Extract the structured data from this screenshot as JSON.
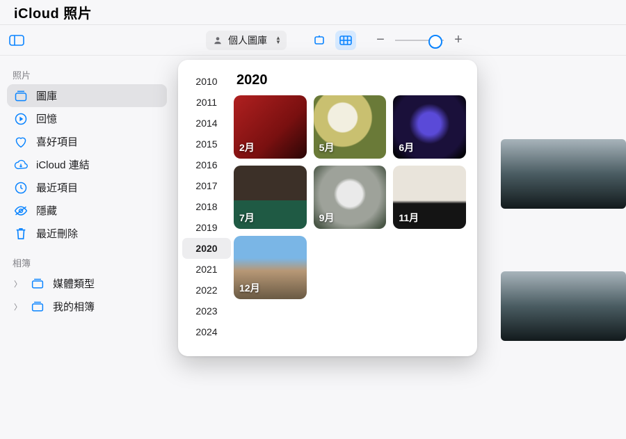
{
  "header": {
    "app_name": "iCloud",
    "app_suffix": "照片"
  },
  "toolbar": {
    "library_label": "個人圖庫",
    "zoom_minus": "−",
    "zoom_plus": "+"
  },
  "sidebar": {
    "section_photos": "照片",
    "section_albums": "相簿",
    "items": [
      {
        "label": "圖庫"
      },
      {
        "label": "回憶"
      },
      {
        "label": "喜好項目"
      },
      {
        "label": "iCloud 連結"
      },
      {
        "label": "最近項目"
      },
      {
        "label": "隱藏"
      },
      {
        "label": "最近刪除"
      }
    ],
    "albums": [
      {
        "label": "媒體類型"
      },
      {
        "label": "我的相簿"
      }
    ]
  },
  "panel": {
    "title": "2020",
    "years": [
      "2010",
      "2011",
      "2014",
      "2015",
      "2016",
      "2017",
      "2018",
      "2019",
      "2020",
      "2021",
      "2022",
      "2023",
      "2024"
    ],
    "selected_year": "2020",
    "months": [
      {
        "label": "2月"
      },
      {
        "label": "5月"
      },
      {
        "label": "6月"
      },
      {
        "label": "7月"
      },
      {
        "label": "9月"
      },
      {
        "label": "11月"
      },
      {
        "label": "12月"
      }
    ]
  }
}
